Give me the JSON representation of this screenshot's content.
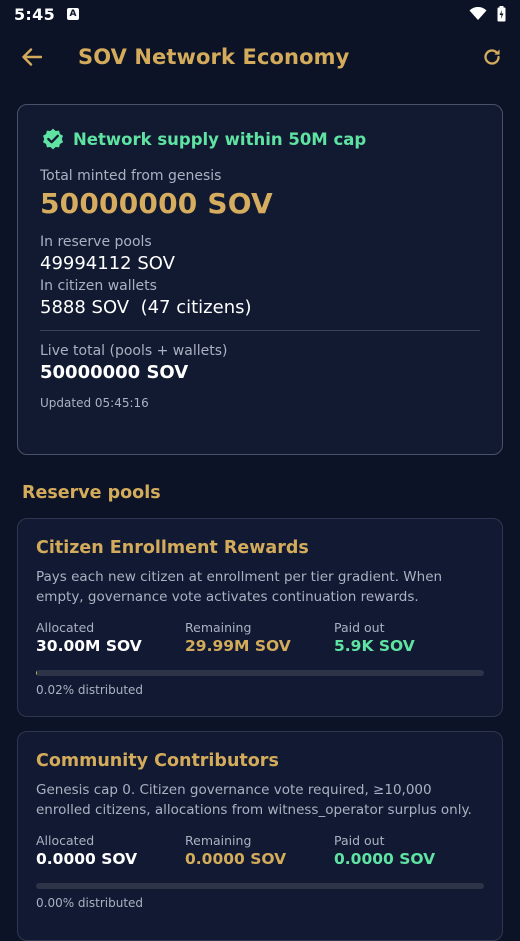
{
  "status": {
    "time": "5:45",
    "notification_badge": "A"
  },
  "header": {
    "title": "SOV Network Economy",
    "back_icon": "arrow-left-icon",
    "refresh_icon": "refresh-icon"
  },
  "summary": {
    "verified_text": "Network supply within 50M cap",
    "verified_icon": "verified-badge-icon",
    "total_minted_label": "Total minted from genesis",
    "total_minted_value": "50000000 SOV",
    "reserve_label": "In reserve pools",
    "reserve_value": "49994112 SOV",
    "wallets_label": "In citizen wallets",
    "wallets_value": "5888 SOV  (47 citizens)",
    "live_total_label": "Live total (pools + wallets)",
    "live_total_value": "50000000 SOV",
    "updated": "Updated 05:45:16"
  },
  "section": {
    "title": "Reserve pools"
  },
  "pools": [
    {
      "title": "Citizen Enrollment Rewards",
      "description": "Pays each new citizen at enrollment per tier gradient. When empty, governance vote activates continuation rewards.",
      "allocated_label": "Allocated",
      "allocated_value": "30.00M SOV",
      "remaining_label": "Remaining",
      "remaining_value": "29.99M SOV",
      "paid_label": "Paid out",
      "paid_value": "5.9K SOV",
      "distributed_fraction": 0.0002,
      "distributed_text": "0.02% distributed"
    },
    {
      "title": "Community Contributors",
      "description": "Genesis cap 0. Citizen governance vote required, ≥10,000 enrolled citizens, allocations from witness_operator surplus only.",
      "allocated_label": "Allocated",
      "allocated_value": "0.0000 SOV",
      "remaining_label": "Remaining",
      "remaining_value": "0.0000 SOV",
      "paid_label": "Paid out",
      "paid_value": "0.0000 SOV",
      "distributed_fraction": 0,
      "distributed_text": "0.00% distributed"
    }
  ],
  "colors": {
    "background": "#0d1327",
    "accent_gold": "#d3ab5b",
    "accent_green": "#5fe3a2",
    "muted_text": "#aab1c2"
  }
}
